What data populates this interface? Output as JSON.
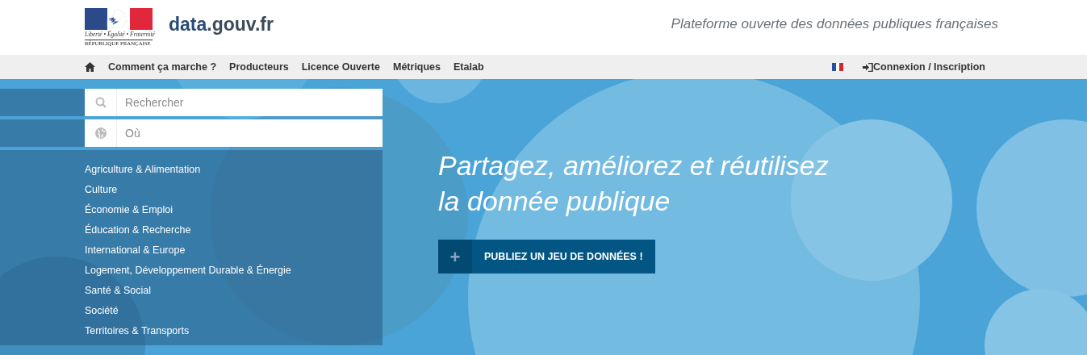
{
  "header": {
    "logo": {
      "motto": "Liberté • Égalité • Fraternité",
      "country": "RÉPUBLIQUE FRANÇAISE"
    },
    "site_name_parts": [
      "data",
      ".gouv.fr"
    ],
    "tagline": "Plateforme ouverte des données publiques françaises"
  },
  "nav": {
    "items": [
      "Comment ça marche ?",
      "Producteurs",
      "Licence Ouverte",
      "Métriques",
      "Etalab"
    ],
    "login": "Connexion / Inscription"
  },
  "search": [
    {
      "kind": "search",
      "placeholder": "Rechercher"
    },
    {
      "kind": "place",
      "placeholder": "Où"
    }
  ],
  "categories": [
    "Agriculture & Alimentation",
    "Culture",
    "Économie & Emploi",
    "Éducation & Recherche",
    "International & Europe",
    "Logement, Développement Durable & Énergie",
    "Santé & Social",
    "Société",
    "Territoires & Transports"
  ],
  "hero": {
    "title_lines": [
      "Partagez, améliorez et réutilisez",
      "la donnée publique"
    ],
    "button": {
      "icon": "+",
      "label": "PUBLIEZ UN JEU DE DONNÉES !"
    }
  }
}
